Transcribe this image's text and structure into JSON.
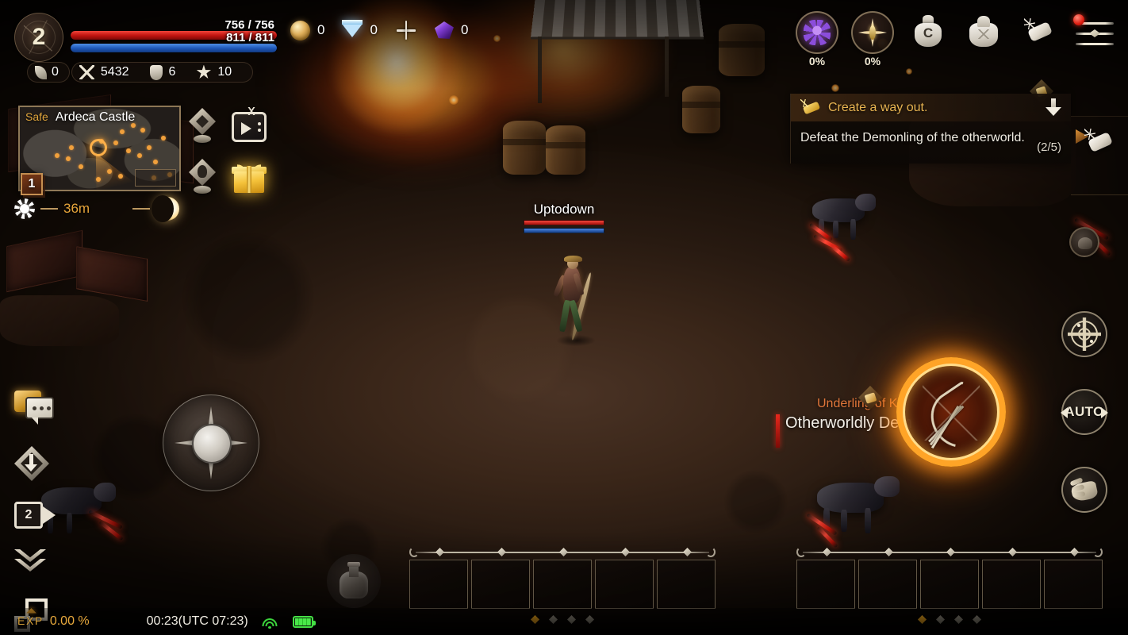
{
  "player": {
    "level": "2",
    "hp_current": 756,
    "hp_max": 756,
    "hp_text": "756 / 756",
    "mp_current": 811,
    "mp_max": 811,
    "mp_text": "811 / 811",
    "class_icon": "bow-emblem-icon",
    "stats": [
      {
        "icon": "leaf-icon",
        "name": "leaf-stat",
        "value": "0"
      },
      {
        "icon": "crossed-swords-icon",
        "name": "attack-stat",
        "value": "5432"
      },
      {
        "icon": "shield-icon",
        "name": "defense-stat",
        "value": "6"
      },
      {
        "icon": "star-icon",
        "name": "rating-stat",
        "value": "10"
      }
    ],
    "nameplate": {
      "name": "Uptodown",
      "hp_pct": 100,
      "mp_pct": 100
    }
  },
  "currency": [
    {
      "icon": "gold-coin-icon",
      "name": "gold",
      "value": "0"
    },
    {
      "icon": "diamond-icon",
      "name": "diamond",
      "value": "0"
    }
  ],
  "currency_add_label": "+",
  "currency_extra": {
    "icon": "purple-crystal-icon",
    "name": "crystal",
    "value": "0"
  },
  "top_right": [
    {
      "name": "spider-buff-icon",
      "icon": "spider-icon",
      "label": "0%"
    },
    {
      "name": "compass-buff-icon",
      "icon": "four-point-star-icon",
      "label": "0%"
    },
    {
      "name": "coin-bag-icon",
      "icon": "bag-icon",
      "label": "C"
    },
    {
      "name": "mail-icon",
      "icon": "mailbag-icon",
      "label": ""
    },
    {
      "name": "scroll-icon",
      "icon": "scroll-icon",
      "label": ""
    },
    {
      "name": "menu-icon",
      "icon": "hamburger-menu-icon",
      "label": "",
      "notification": true
    }
  ],
  "minimap": {
    "safe_label": "Safe",
    "zone_name": "Ardeca Castle",
    "channel": "1",
    "daynight": {
      "sun_icon": "sun-icon",
      "time_remaining": "36m",
      "moon_icon": "moon-icon"
    }
  },
  "map_side_buttons": [
    {
      "name": "waypoint-pin-icon",
      "icon": "diamond-pin-icon"
    },
    {
      "name": "video-player-icon",
      "icon": "tv-icon"
    },
    {
      "name": "character-pin-icon",
      "icon": "person-pin-icon"
    },
    {
      "name": "gift-reward-icon",
      "icon": "gift-box-icon"
    }
  ],
  "quest": {
    "title": "Create a way out.",
    "description": "Defeat the Demonling of the otherworld.",
    "progress": "(2/5)",
    "collapse_icon": "collapse-down-icon",
    "scroll_icon": "quest-scroll-icon",
    "item_icon": "quest-item-icon"
  },
  "right_tab": {
    "icon": "scroll-icon"
  },
  "boss": {
    "subtitle": "Underling of K",
    "name": "Otherworldly Dem",
    "item_icon": "loot-item-icon"
  },
  "controls": {
    "joystick": {
      "name": "movement-joystick",
      "icon": "four-point-star-icon"
    },
    "potion": {
      "name": "potion-button",
      "icon": "flask-icon"
    },
    "attack": {
      "name": "basic-attack-button",
      "icon": "bow-and-arrows-icon"
    },
    "right_buttons": [
      {
        "name": "target-lock-button",
        "icon": "crosshair-radar-icon",
        "label": ""
      },
      {
        "name": "auto-battle-button",
        "icon": "auto-cycle-icon",
        "label": "AUTO"
      },
      {
        "name": "interact-button",
        "icon": "hand-icon",
        "label": ""
      }
    ],
    "left_buttons": [
      {
        "name": "chat-button",
        "icon": "chat-bubble-icon"
      },
      {
        "name": "pickup-button",
        "icon": "download-diamond-icon"
      },
      {
        "name": "camera-button",
        "icon": "camera-icon",
        "label": "2"
      },
      {
        "name": "collapse-hud-button",
        "icon": "double-chevron-down-icon"
      },
      {
        "name": "resize-hud-button",
        "icon": "resize-window-icon"
      }
    ]
  },
  "skillbars": [
    {
      "name": "skillbar-left",
      "slots": [
        "",
        "",
        "",
        "",
        ""
      ],
      "pages": 4,
      "active_page": 0
    },
    {
      "name": "skillbar-right",
      "slots": [
        "",
        "",
        "",
        "",
        ""
      ],
      "pages": 4,
      "active_page": 0
    }
  ],
  "statusbar": {
    "exp_label": "EXP",
    "exp_value": "0.00 %",
    "clock": "00:23(UTC 07:23)",
    "wifi_icon": "wifi-icon",
    "battery_icon": "battery-icon"
  },
  "colors": {
    "accent_gold": "#e8a93c",
    "hp_red": "#c01410",
    "mp_blue": "#1f59ba",
    "attack_ring": "#ffa427",
    "safe_gold": "#e0a53c",
    "boss_orange": "#e0763a",
    "status_green": "#44e044"
  }
}
